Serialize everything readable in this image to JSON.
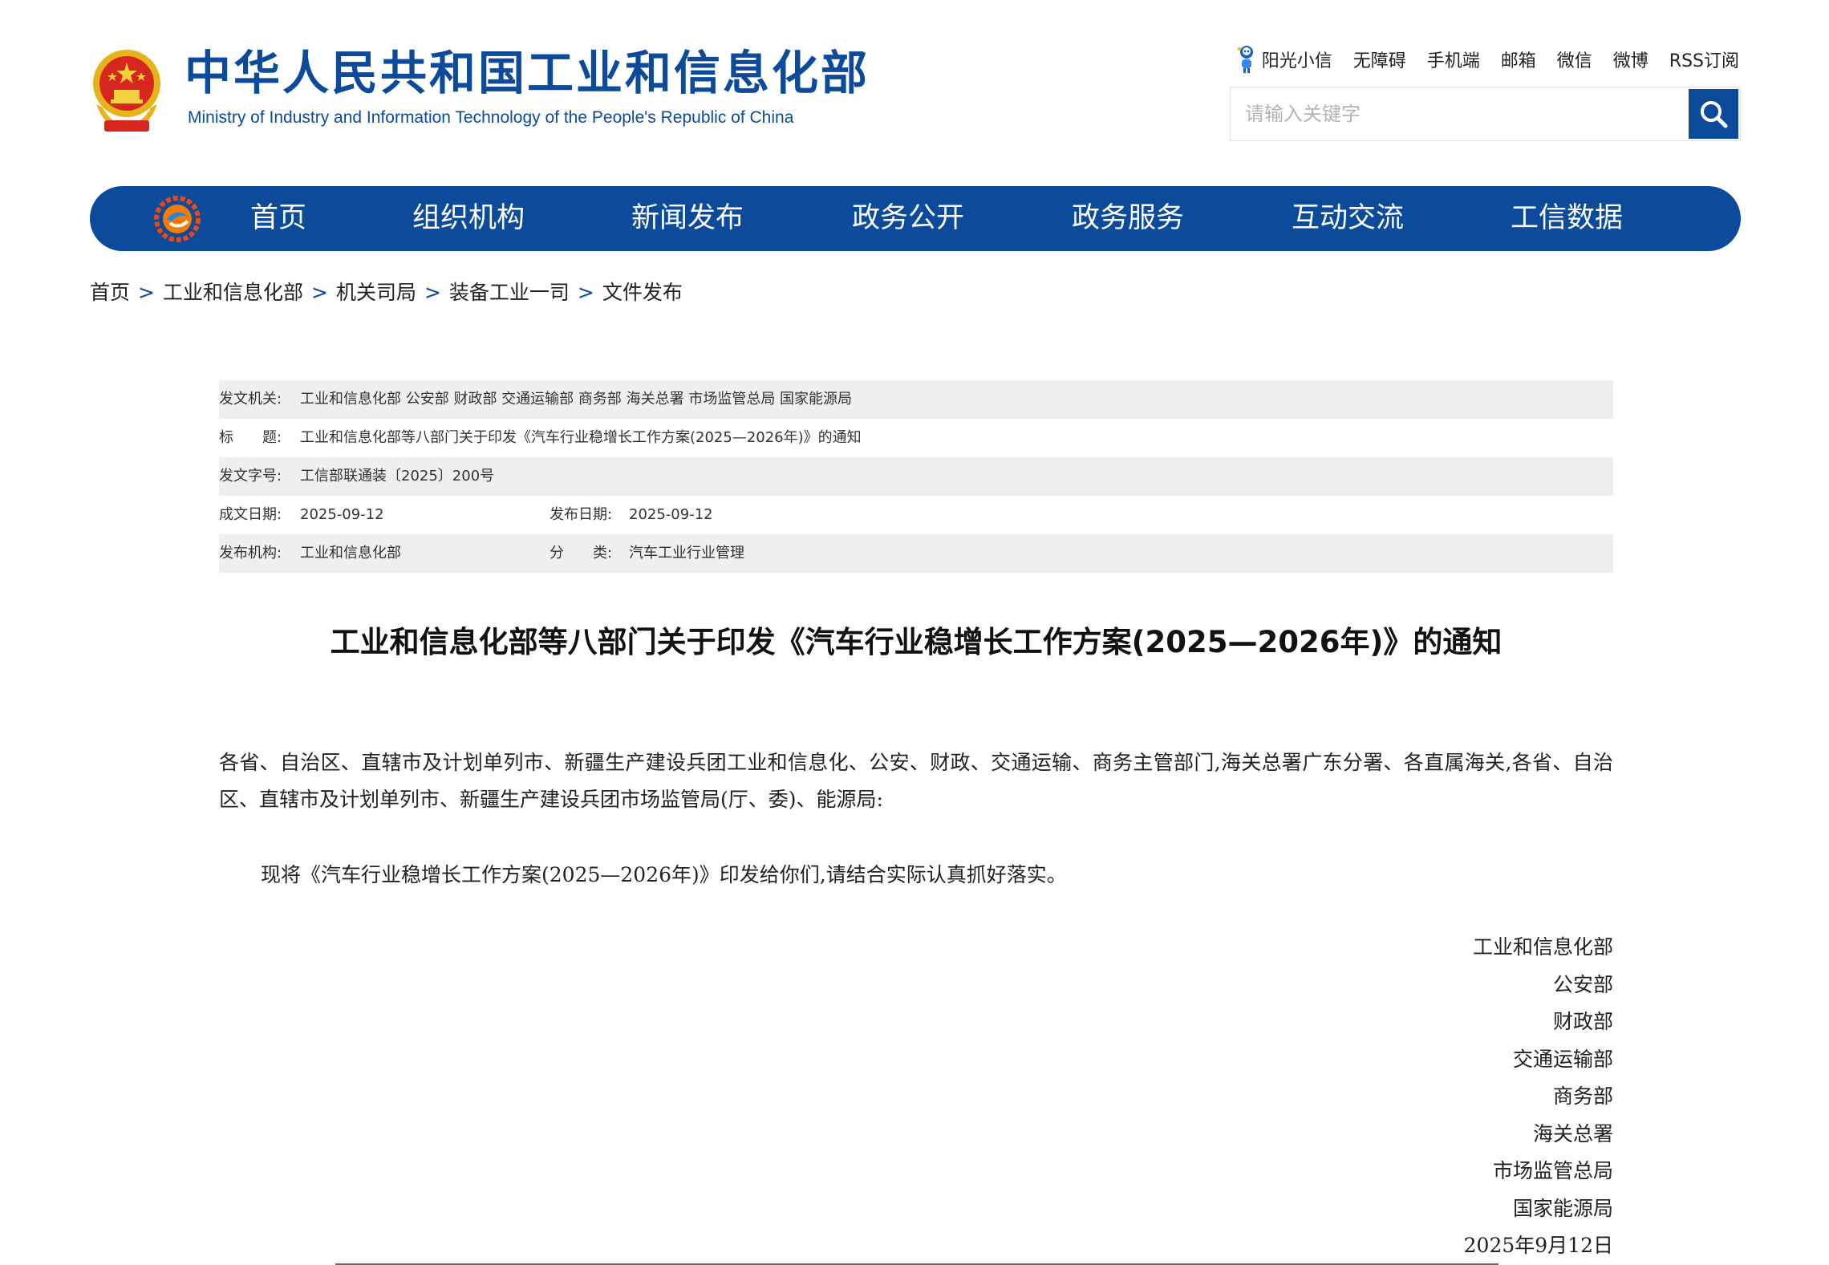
{
  "header": {
    "title": "中华人民共和国工业和信息化部",
    "subtitle": "Ministry of Industry and Information Technology of the People's Republic of China",
    "top_links": [
      "阳光小信",
      "无障碍",
      "手机端",
      "邮箱",
      "微信",
      "微博",
      "RSS订阅"
    ],
    "search_placeholder": "请输入关键字"
  },
  "nav": {
    "items": [
      "首页",
      "组织机构",
      "新闻发布",
      "政务公开",
      "政务服务",
      "互动交流",
      "工信数据"
    ]
  },
  "breadcrumb": [
    "首页",
    "工业和信息化部",
    "机关司局",
    "装备工业一司",
    "文件发布"
  ],
  "meta": {
    "issuer_label": "发文机关:",
    "issuer": "工业和信息化部 公安部 财政部 交通运输部 商务部 海关总署 市场监管总局 国家能源局",
    "title_label": "标　　题:",
    "title": "工业和信息化部等八部门关于印发《汽车行业稳增长工作方案(2025—2026年)》的通知",
    "doc_no_label": "发文字号:",
    "doc_no": "工信部联通装〔2025〕200号",
    "created_label": "成文日期:",
    "created": "2025-09-12",
    "published_label": "发布日期:",
    "published": "2025-09-12",
    "org_label": "发布机构:",
    "org": "工业和信息化部",
    "category_label": "分　　类:",
    "category": "汽车工业行业管理"
  },
  "document": {
    "title": "工业和信息化部等八部门关于印发《汽车行业稳增长工作方案(2025—2026年)》的通知",
    "addressee": "各省、自治区、直辖市及计划单列市、新疆生产建设兵团工业和信息化、公安、财政、交通运输、商务主管部门,海关总署广东分署、各直属海关,各省、自治区、直辖市及计划单列市、新疆生产建设兵团市场监管局(厅、委)、能源局:",
    "paragraph": "现将《汽车行业稳增长工作方案(2025—2026年)》印发给你们,请结合实际认真抓好落实。",
    "signers": [
      "工业和信息化部",
      "公安部",
      "财政部",
      "交通运输部",
      "商务部",
      "海关总署",
      "市场监管总局",
      "国家能源局"
    ],
    "date": "2025年9月12日"
  },
  "colors": {
    "brand_blue": "#0c4a9c",
    "meta_row_bg": "#efefef"
  }
}
